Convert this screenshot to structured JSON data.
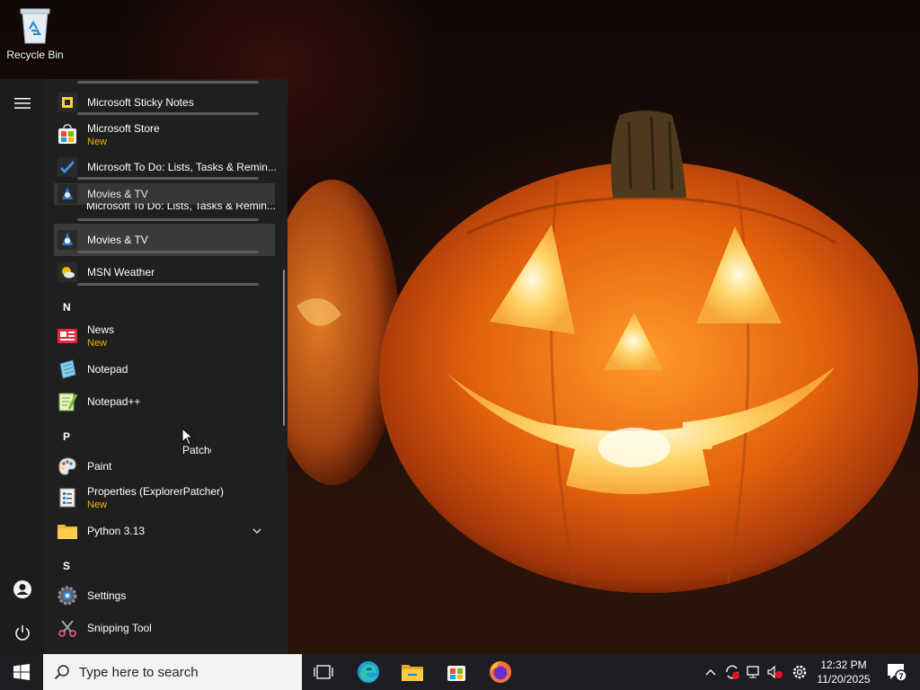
{
  "desktop": {
    "recycle_bin_label": "Recycle Bin"
  },
  "start_menu": {
    "rail": {
      "menu_icon": "hamburger-menu-icon",
      "user_icon": "user-account-icon",
      "power_icon": "power-icon"
    },
    "apps": [
      {
        "name": "Microsoft Sticky Notes",
        "badge": "",
        "icon": "sticky-notes-icon"
      },
      {
        "name": "Microsoft Store",
        "badge": "New",
        "icon": "store-icon"
      },
      {
        "name": "Microsoft To Do: Lists, Tasks & Remin...",
        "badge": "",
        "icon": "todo-icon"
      },
      {
        "name": "Movies & TV",
        "badge": "",
        "icon": "movies-tv-icon"
      },
      {
        "name": "Microsoft To Do: Lists, Tasks & Remin...",
        "badge": "",
        "icon": "todo-icon"
      },
      {
        "name": "Movies & TV",
        "badge": "",
        "icon": "movies-tv-icon"
      },
      {
        "name": "MSN Weather",
        "badge": "",
        "icon": "weather-icon"
      },
      {
        "name": "News",
        "badge": "New",
        "icon": "news-icon"
      },
      {
        "name": "Notepad",
        "badge": "",
        "icon": "notepad-icon"
      },
      {
        "name": "Notepad++",
        "badge": "",
        "icon": "notepad-plus-plus-icon"
      },
      {
        "name": "Paint",
        "badge": "",
        "icon": "paint-icon"
      },
      {
        "name": "Properties (ExplorerPatcher)",
        "badge": "New",
        "icon": "properties-icon"
      },
      {
        "name": "Python 3.13",
        "badge": "",
        "icon": "folder-icon"
      },
      {
        "name": "Settings",
        "badge": "",
        "icon": "gear-icon"
      },
      {
        "name": "Snipping Tool",
        "badge": "",
        "icon": "snipping-tool-icon"
      }
    ],
    "letters": [
      "N",
      "P",
      "S"
    ],
    "drag_ghost_text": "Patche"
  },
  "taskbar": {
    "search_placeholder": "Type here to search",
    "pinned": [
      "task-view-icon",
      "edge-icon",
      "file-explorer-icon",
      "store-icon",
      "firefox-icon"
    ],
    "clock": {
      "time": "12:32 PM",
      "date": "11/20/2025"
    },
    "notification_count": "7"
  },
  "colors": {
    "accent_new": "#f0b300",
    "start_bg": "#1f1f1f",
    "taskbar_bg": "#1c1e22"
  }
}
